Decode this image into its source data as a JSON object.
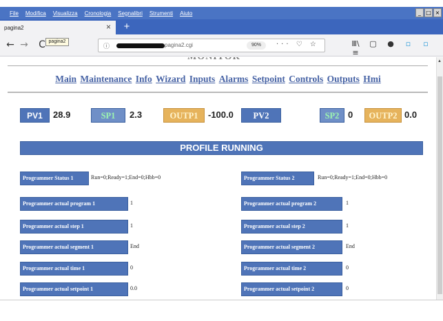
{
  "menubar": {
    "items": [
      "File",
      "Modifica",
      "Visualizza",
      "Cronologia",
      "Segnalibri",
      "Strumenti",
      "Aiuto"
    ]
  },
  "window_controls": {
    "minimize": "_",
    "maximize": "□",
    "close": "×"
  },
  "tab": {
    "title": "pagina2",
    "close": "×",
    "new_tab": "+"
  },
  "navbar": {
    "back": "←",
    "forward": "→",
    "reload": "C",
    "reload_tooltip": "pagina2",
    "info_icon": "ⓘ",
    "url_visible": "pagina2.cgi",
    "zoom": "90%",
    "page_actions": "··· ♡ ☆",
    "toolbar_icons": [
      "Ⅲ\\",
      "▢",
      "●",
      "▫",
      "▫",
      "≡"
    ]
  },
  "page": {
    "heading_partial": "MONITOR",
    "nav_links": [
      "Main",
      "Maintenance",
      "Info",
      "Wizard",
      "Inputs",
      "Alarms",
      "Setpoint",
      "Controls",
      "Outputs",
      "Hmi"
    ],
    "pv_row": {
      "pv1_label": "PV1",
      "pv1_value": "28.9",
      "sp1_label": "SP1",
      "sp1_value": "2.3",
      "outp1_label": "OUTP1",
      "outp1_value": "-100.0",
      "pv2_label": "PV2",
      "pv2_value": "",
      "sp2_label": "SP2",
      "sp2_value": "0",
      "outp2_label": "OUTP2",
      "outp2_value": "0.0"
    },
    "banner": "PROFILE RUNNING",
    "left_rows": [
      {
        "label": "Programmer Status 1",
        "value": "Run=0;Ready=1;End=0;Hbb=0"
      },
      {
        "label": "Programmer actual  program 1",
        "value": "1"
      },
      {
        "label": "Programmer actual  step 1",
        "value": "1"
      },
      {
        "label": "Programmer actual segment  1",
        "value": "End"
      },
      {
        "label": "Programmer actual time  1",
        "value": "0"
      },
      {
        "label": "Programmer actual setpoint  1",
        "value": "0.0"
      }
    ],
    "right_rows": [
      {
        "label": "Programmer Status 2",
        "value": "Run=0;Ready=1;End=0;Hbb=0"
      },
      {
        "label": "Programmer actual  program 2",
        "value": "1"
      },
      {
        "label": "Programmer actual  step 2",
        "value": "1"
      },
      {
        "label": "Programmer actual segment  2",
        "value": "End"
      },
      {
        "label": "Programmer actual time  2",
        "value": "0"
      },
      {
        "label": "Programmer actual setpoint  2",
        "value": "0"
      }
    ]
  },
  "colors": {
    "menubar": "#4a74c4",
    "tabbar": "#3c66bd",
    "label_blue": "#4f74b8",
    "sp_text": "#9df5b0",
    "outp_bg": "#e6b35c",
    "link": "#4763a5"
  }
}
